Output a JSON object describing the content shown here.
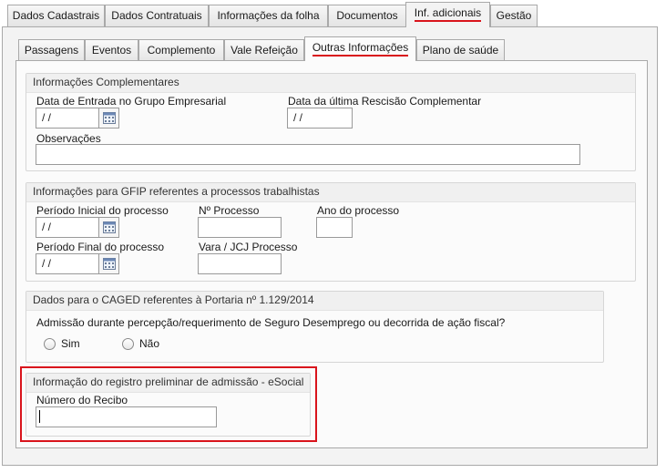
{
  "main_tabs": [
    {
      "label": "Dados Cadastrais"
    },
    {
      "label": "Dados Contratuais"
    },
    {
      "label": "Informações da folha"
    },
    {
      "label": "Documentos"
    },
    {
      "label": "Inf. adicionais"
    },
    {
      "label": "Gestão"
    }
  ],
  "active_main_tab": "Inf. adicionais",
  "sub_tabs": [
    {
      "label": "Passagens"
    },
    {
      "label": "Eventos"
    },
    {
      "label": "Complemento"
    },
    {
      "label": "Vale Refeição"
    },
    {
      "label": "Outras Informações"
    },
    {
      "label": "Plano de saúde"
    }
  ],
  "active_sub_tab": "Outras Informações",
  "complementares": {
    "title": "Informações Complementares",
    "entrada_label": "Data de Entrada no Grupo Empresarial",
    "entrada_value": " /  /",
    "rescisao_label": "Data da última Rescisão Complementar",
    "rescisao_value": " /  /",
    "observacoes_label": "Observações",
    "observacoes_value": ""
  },
  "gfip": {
    "title": "Informações para GFIP referentes a processos trabalhistas",
    "periodo_inicial_label": "Período Inicial do processo",
    "periodo_inicial_value": " /  /",
    "n_processo_label": "Nº Processo",
    "n_processo_value": "",
    "ano_label": "Ano do processo",
    "ano_value": "",
    "periodo_final_label": "Período Final do processo",
    "periodo_final_value": " /  /",
    "vara_label": "Vara / JCJ Processo",
    "vara_value": ""
  },
  "caged": {
    "title": "Dados para o CAGED referentes à Portaria nº 1.129/2014",
    "question": "Admissão durante percepção/requerimento de Seguro Desemprego ou decorrida de ação fiscal?",
    "option_sim": "Sim",
    "option_nao": "Não",
    "selected": ""
  },
  "esocial": {
    "title": "Informação do registro preliminar de admissão - eSocial",
    "recibo_label": "Número do Recibo",
    "recibo_value": ""
  },
  "colors": {
    "accent": "#d9141c",
    "panel": "#f3f3f3",
    "border": "#a9a9a9"
  }
}
